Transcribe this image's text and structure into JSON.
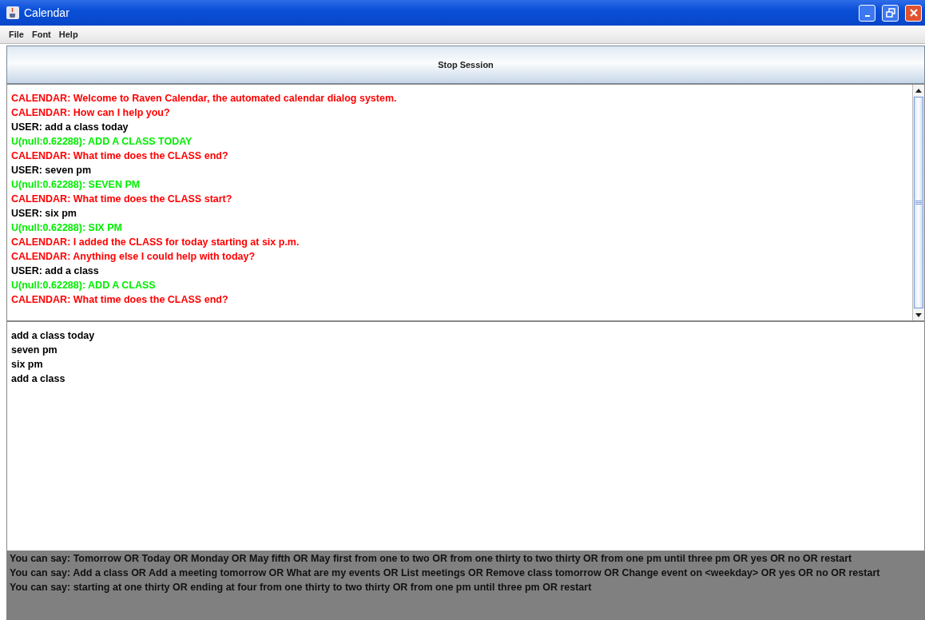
{
  "window": {
    "title": "Calendar"
  },
  "menu": [
    "File",
    "Font",
    "Help"
  ],
  "session_button": {
    "label": "Stop Session"
  },
  "log": [
    {
      "kind": "system",
      "text": "CALENDAR: Welcome to Raven Calendar, the automated calendar dialog system."
    },
    {
      "kind": "system",
      "text": "CALENDAR: How can I help you?"
    },
    {
      "kind": "user",
      "text": "USER: add a class today"
    },
    {
      "kind": "recognized",
      "text": "U(null:0.62288): ADD A CLASS TODAY"
    },
    {
      "kind": "system",
      "text": "CALENDAR: What time does the CLASS end?"
    },
    {
      "kind": "user",
      "text": "USER: seven pm"
    },
    {
      "kind": "recognized",
      "text": "U(null:0.62288): SEVEN PM"
    },
    {
      "kind": "system",
      "text": "CALENDAR: What time does the CLASS start?"
    },
    {
      "kind": "user",
      "text": "USER: six pm"
    },
    {
      "kind": "recognized",
      "text": "U(null:0.62288): SIX PM"
    },
    {
      "kind": "system",
      "text": "CALENDAR: I added the CLASS for today starting at six p.m."
    },
    {
      "kind": "system",
      "text": "CALENDAR: Anything else I could help with today?"
    },
    {
      "kind": "user",
      "text": "USER: add a class"
    },
    {
      "kind": "recognized",
      "text": "U(null:0.62288): ADD A CLASS"
    },
    {
      "kind": "system",
      "text": "CALENDAR: What time does the CLASS end?"
    }
  ],
  "input_lines": [
    "add a class today",
    "seven pm",
    "six pm",
    "add a class"
  ],
  "hints": [
    "You can say: Tomorrow OR Today OR Monday OR May fifth OR May first from one to two OR from one thirty to two thirty OR from one pm until three pm OR yes OR no OR restart",
    "You can say: Add a class OR Add a meeting tomorrow OR What are my events OR List meetings OR  Remove class tomorrow OR Change event on <weekday> OR  yes OR no OR restart",
    "You can say: starting at one thirty OR ending at four from one thirty to two thirty OR from one pm until three pm OR restart"
  ]
}
